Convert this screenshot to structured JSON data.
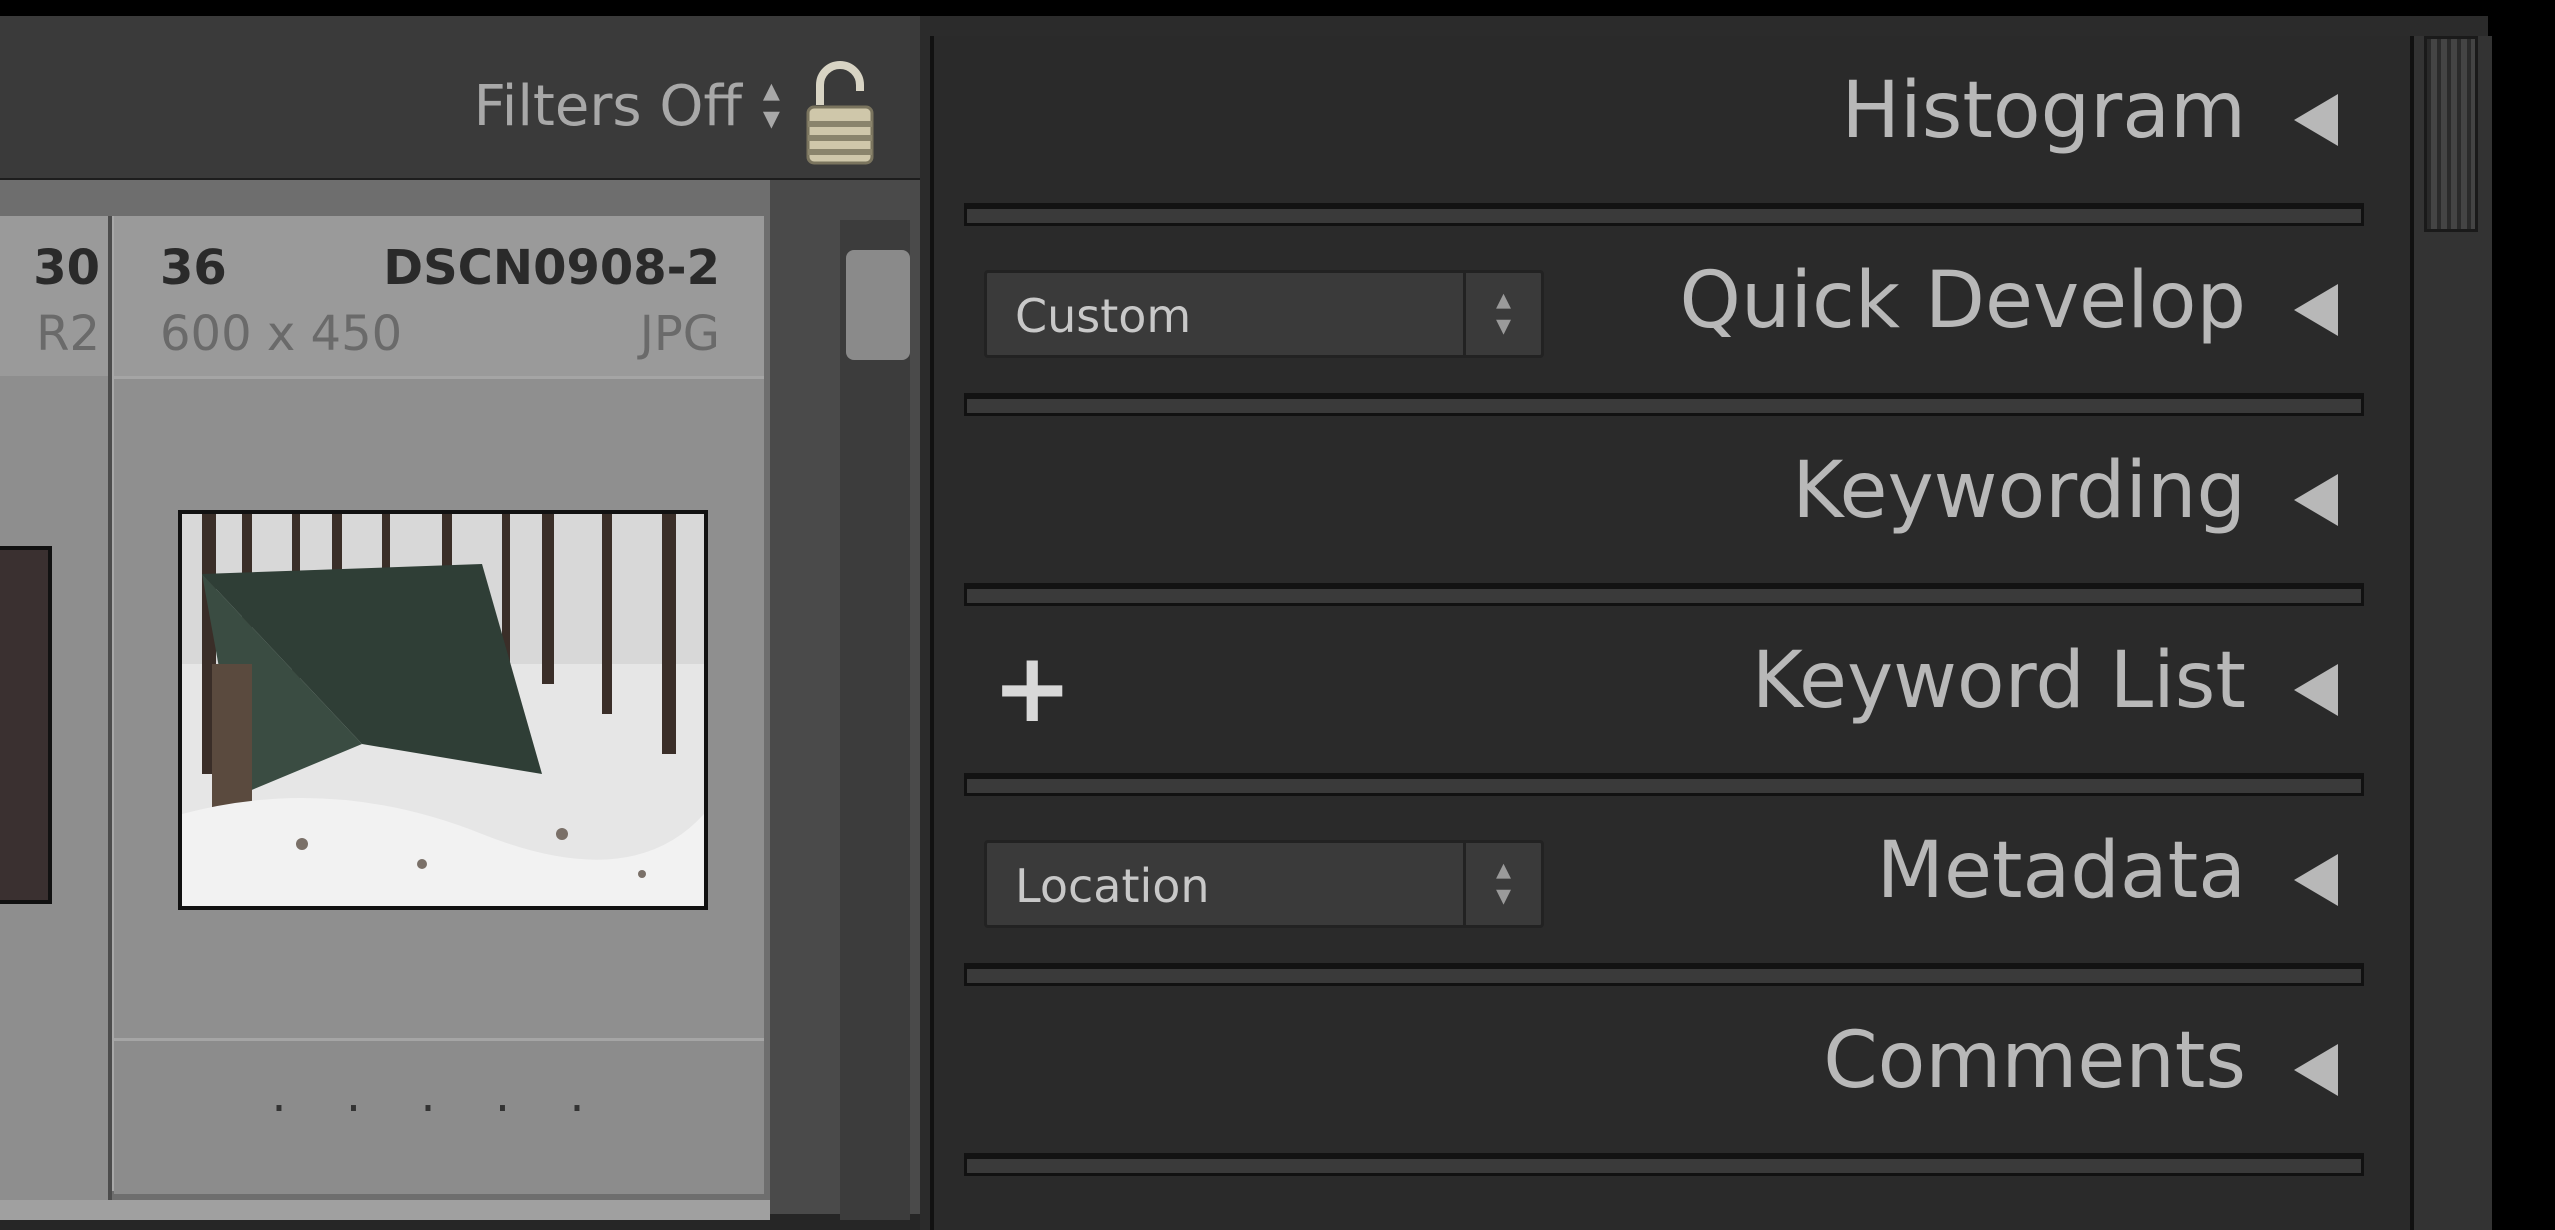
{
  "filterbar": {
    "filters_label": "Filters Off",
    "filters_arrows": "⬍"
  },
  "grid": {
    "left_stub": {
      "line1": "30",
      "line2": "R2"
    },
    "cell": {
      "index": "36",
      "filename": "DSCN0908-2",
      "dimensions": "600 x 450",
      "filetype": "JPG",
      "rating_dots": "· · · · ·"
    }
  },
  "panel": {
    "sections": [
      {
        "title": "Histogram"
      },
      {
        "title": "Quick Develop",
        "select": "Custom"
      },
      {
        "title": "Keywording"
      },
      {
        "title": "Keyword List",
        "plus": "+"
      },
      {
        "title": "Metadata",
        "select": "Location"
      },
      {
        "title": "Comments"
      }
    ]
  },
  "colors": {
    "panel_bg": "#2a2a2a",
    "grid_bg": "#8f8f8f",
    "text_light": "#b8b8b8"
  },
  "icons": [
    "lock-icon",
    "collapse-triangle-icon",
    "plus-icon",
    "stepper-arrows-icon"
  ]
}
